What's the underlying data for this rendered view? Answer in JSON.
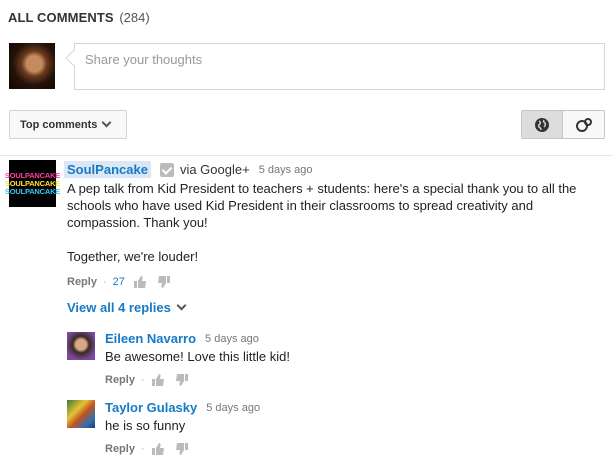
{
  "header": {
    "title": "ALL COMMENTS",
    "count": "(284)"
  },
  "share": {
    "placeholder": "Share your thoughts"
  },
  "sort": {
    "label": "Top comments"
  },
  "comment": {
    "author": "SoulPancake",
    "via": "via Google+",
    "time": "5 days ago",
    "body1": "A pep talk from Kid President to teachers + students: here's a special thank you to all the schools who have used Kid President in their classrooms to spread creativity and compassion. Thank you!",
    "body2": "Together, we're louder!",
    "reply": "Reply",
    "likes": "27",
    "logo": [
      "SOULPANCAKE",
      "SOULPANCAKE",
      "SOULPANCAKE"
    ]
  },
  "view_all": "View all 4 replies",
  "replies": [
    {
      "author": "Eileen Navarro",
      "time": "5 days ago",
      "body": "Be awesome! Love this little kid!",
      "reply": "Reply"
    },
    {
      "author": "Taylor Gulasky",
      "time": "5 days ago",
      "body": "he is so funny",
      "reply": "Reply"
    }
  ],
  "colors": {
    "link": "#167ac6",
    "highlight": "#dbe7f4"
  }
}
